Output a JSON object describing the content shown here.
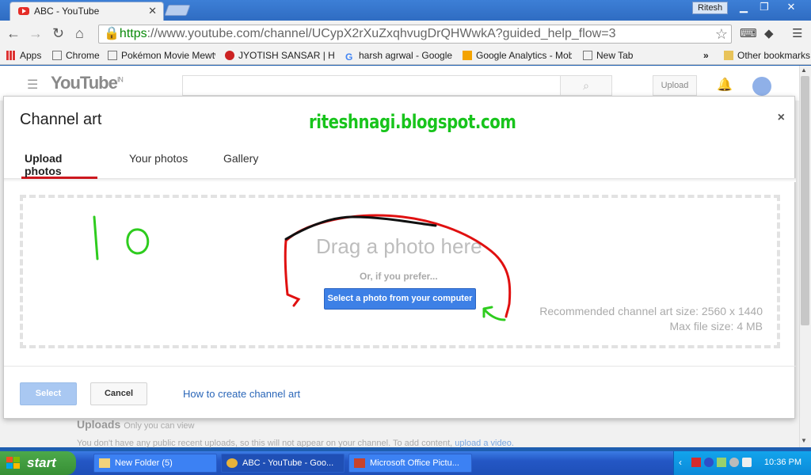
{
  "browser": {
    "tab_title": "ABC - YouTube",
    "user": "Ritesh",
    "url_scheme": "https",
    "url_rest": "://www.youtube.com/channel/UCypX2rXuZxqhvugDrQHWwkA?guided_help_flow=3",
    "bookmarks": [
      "Apps",
      "Chrome",
      "Pokémon Movie Mewtwo",
      "JYOTISH SANSAR | Hind",
      "harsh agrwal - Google",
      "Google Analytics - Mobile",
      "New Tab"
    ],
    "other_bookmarks": "Other bookmarks",
    "overflow": "»"
  },
  "youtube": {
    "logo_text": "YouTube",
    "region": "IN",
    "upload_label": "Upload",
    "uploads_heading": "Uploads",
    "uploads_sub": "Only you can view",
    "uploads_text": "You don't have any public recent uploads, so this will not appear on your channel. To add content,",
    "uploads_link": "upload a video."
  },
  "dialog": {
    "title": "Channel art",
    "close": "×",
    "watermark": "riteshnagi.blogspot.com",
    "tabs": [
      "Upload photos",
      "Your photos",
      "Gallery"
    ],
    "drag_text": "Drag a photo here",
    "or_text": "Or, if you prefer...",
    "select_photo_button": "Select a photo from your computer",
    "recommended_size": "Recommended channel art size: 2560 x 1440",
    "max_file_size": "Max file size: 4 MB",
    "select_button": "Select",
    "cancel_button": "Cancel",
    "help_link": "How to create channel art",
    "annotation_number": "10"
  },
  "taskbar": {
    "start_label": "start",
    "tasks": [
      "New Folder (5)",
      "ABC - YouTube - Goo...",
      "Microsoft Office Pictu..."
    ],
    "clock": "10:36 PM"
  }
}
